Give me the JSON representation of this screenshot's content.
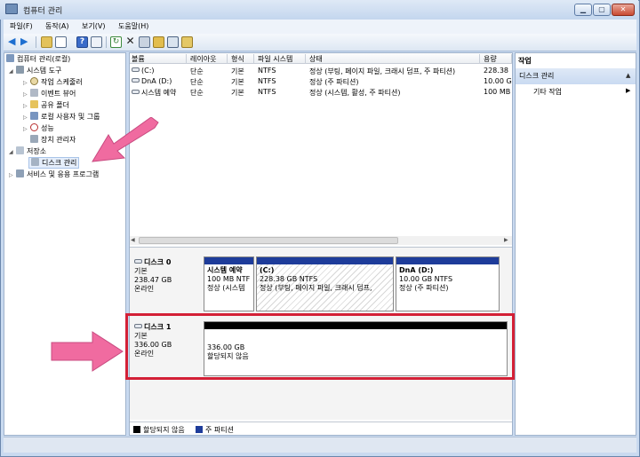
{
  "window": {
    "title": "컴퓨터 관리",
    "controls": [
      "▁",
      "▢",
      "✕"
    ]
  },
  "menu": [
    "파일(F)",
    "동작(A)",
    "보기(V)",
    "도움말(H)"
  ],
  "tree": [
    {
      "label": "컴퓨터 관리(로컬)",
      "level": 0,
      "icon": "computer-icon",
      "expander": ""
    },
    {
      "label": "시스템 도구",
      "level": 1,
      "icon": "tools-icon",
      "expander": "◢"
    },
    {
      "label": "작업 스케줄러",
      "level": 2,
      "icon": "clock-icon",
      "expander": "▷"
    },
    {
      "label": "이벤트 뷰어",
      "level": 2,
      "icon": "event-icon",
      "expander": "▷"
    },
    {
      "label": "공유 폴더",
      "level": 2,
      "icon": "folder-icon",
      "expander": "▷"
    },
    {
      "label": "로컬 사용자 및 그룹",
      "level": 2,
      "icon": "users-icon",
      "expander": "▷"
    },
    {
      "label": "성능",
      "level": 2,
      "icon": "performance-icon",
      "expander": "▷"
    },
    {
      "label": "장치 관리자",
      "level": 2,
      "icon": "device-icon",
      "expander": ""
    },
    {
      "label": "저장소",
      "level": 1,
      "icon": "storage-icon",
      "expander": "◢"
    },
    {
      "label": "디스크 관리",
      "level": 2,
      "icon": "disk-mgmt-icon",
      "expander": "",
      "selected": true
    },
    {
      "label": "서비스 및 응용 프로그램",
      "level": 1,
      "icon": "services-icon",
      "expander": "▷"
    }
  ],
  "volume_list": {
    "columns": [
      "볼륨",
      "레이아웃",
      "형식",
      "파일 시스템",
      "상태",
      "용량"
    ],
    "rows": [
      [
        "(C:)",
        "단순",
        "기본",
        "NTFS",
        "정상 (부팅, 페이지 파일, 크래시 덤프, 주 파티션)",
        "228.38"
      ],
      [
        "DnA (D:)",
        "단순",
        "기본",
        "NTFS",
        "정상 (주 파티션)",
        "10.00 G"
      ],
      [
        "시스템 예약",
        "단순",
        "기본",
        "NTFS",
        "정상 (시스템, 활성, 주 파티션)",
        "100 MB"
      ]
    ]
  },
  "disks": [
    {
      "name": "디스크 0",
      "type": "기본",
      "size": "238.47 GB",
      "status": "온라인",
      "partitions": [
        {
          "label": "시스템 예약",
          "size": "100 MB NTF",
          "status": "정상 (시스템"
        },
        {
          "label": "(C:)",
          "size": "228.38 GB NTFS",
          "status": "정상 (부팅, 페이지 파일, 크래시 덤프,"
        },
        {
          "label": "DnA  (D:)",
          "size": "10.00 GB NTFS",
          "status": "정상 (주 파티션)"
        }
      ]
    },
    {
      "name": "디스크 1",
      "type": "기본",
      "size": "336.00 GB",
      "status": "온라인",
      "partitions": [
        {
          "label": "",
          "size": "336.00 GB",
          "status": "할당되지 않음"
        }
      ]
    }
  ],
  "legend": [
    {
      "label": "할당되지 않음",
      "color": "#000000"
    },
    {
      "label": "주 파티션",
      "color": "#1e3c9a"
    }
  ],
  "actions": {
    "header": "작업",
    "section": "디스크 관리",
    "item": "기타 작업"
  },
  "colors": {
    "highlight": "#d32036",
    "arrow": "#f06ba0",
    "primary_partition": "#1e3c9a"
  }
}
